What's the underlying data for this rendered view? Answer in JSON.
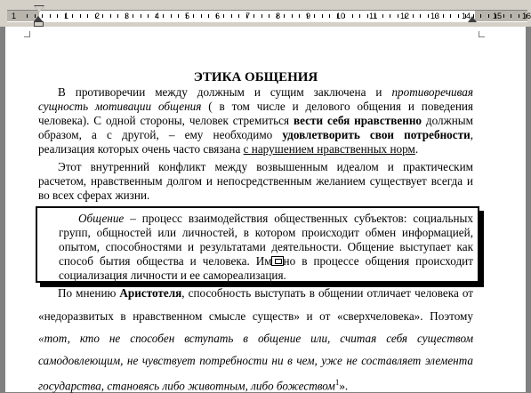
{
  "ruler": {
    "numbers": [
      "1",
      "1",
      "2",
      "3",
      "4",
      "5",
      "6",
      "7",
      "8",
      "9",
      "10",
      "11",
      "12",
      "13",
      "14",
      "15",
      "16"
    ]
  },
  "document": {
    "title": "ЭТИКА ОБЩЕНИЯ",
    "p1": [
      {
        "a": "В противоречии между должным и сущим заключена и ",
        "i": "противоречивая"
      },
      {
        "i": "сущность мотивации общения",
        "a": " ( в том числе и делового общения и поведения"
      },
      {
        "a": "человека). С одной стороны, человек стремиться ",
        "b": "вести себя нравственно",
        "c": " должным"
      },
      {
        "a": "образом, а с другой, – ему необходимо ",
        "b": "удовлетворить свои потребности",
        "c": ","
      },
      {
        "a": "реализация которых очень часто связана ",
        "u": "с нарушением нравственных норм",
        "c": "."
      }
    ],
    "p2": [
      "Этот внутренний конфликт между возвышенным идеалом и практическим",
      "расчетом, нравственным долгом и непосредственным желанием существует всегда и",
      "во всех сферах жизни."
    ],
    "definition": [
      {
        "i": "Общение",
        "a": " – процесс взаимодействия общественных субъектов: социальных"
      },
      {
        "a": "групп, общностей или личностей, в котором происходит обмен информацией,"
      },
      {
        "a": "опытом, способностями и результатами деятельности. Общение выступает как"
      },
      {
        "a": "способ бытия общества и человека.  Именно в процессе общения происходит"
      },
      {
        "a": "социализация личности и ее самореализация."
      }
    ],
    "p3": [
      {
        "a": "По мнению ",
        "b": "Аристотеля",
        "c": ", способность выступать в общении отличает человека от"
      },
      {
        "a": "«недоразвитых в нравственном смысле существ»  и от «сверхчеловека». Поэтому"
      },
      {
        "i": "«тот, кто не способен вступать в общение или, считая себя существом"
      },
      {
        "i": "самодовлеющим, не чувствует потребности ни в чем, уже не составляет элемента"
      },
      {
        "i": "государства, становясь либо животным, либо божеством",
        "sup": "1",
        "c": "»."
      }
    ]
  }
}
